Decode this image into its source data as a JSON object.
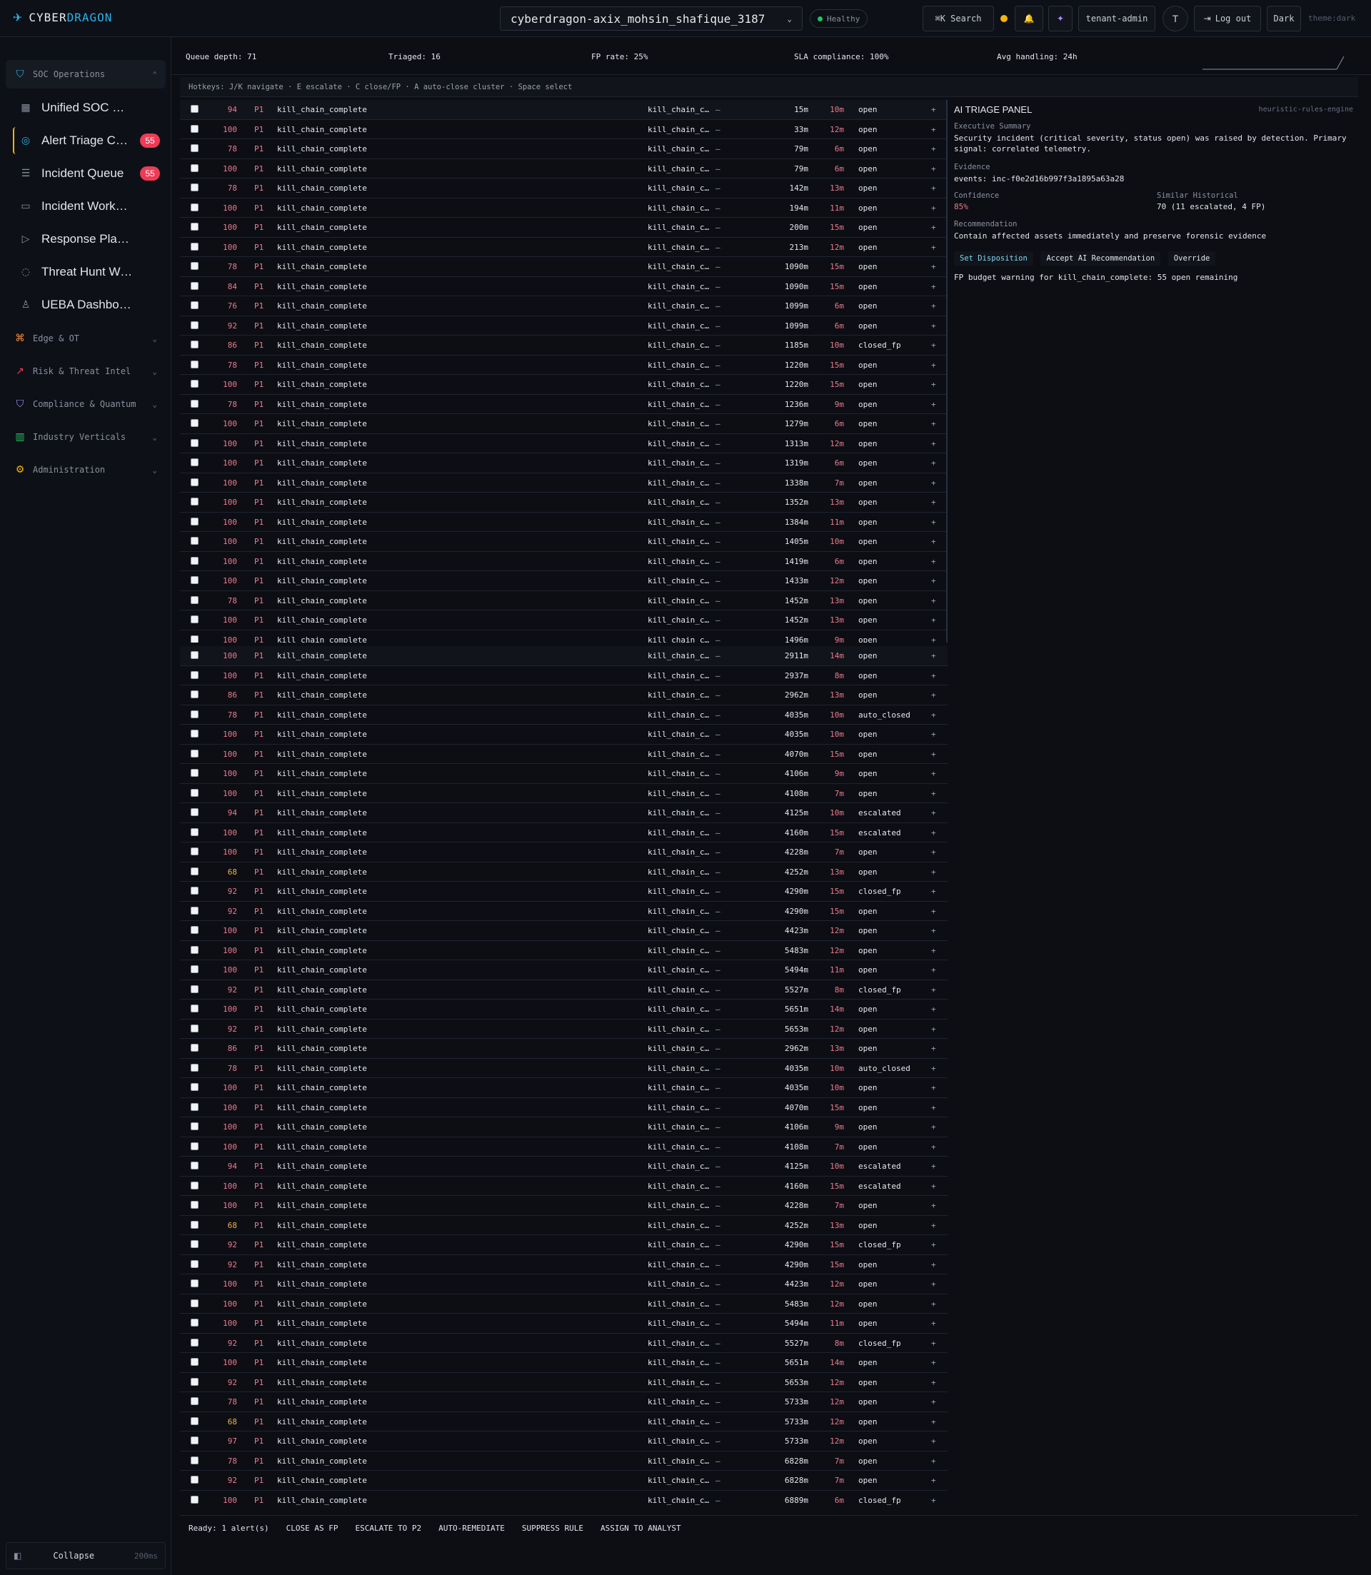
{
  "brand": {
    "part1": "CYBER",
    "part2": "DRAGON"
  },
  "header": {
    "tenant": "cyberdragon-axix_mohsin_shafique_3187",
    "health": "Healthy",
    "search_label": "⌘K  Search",
    "role": "tenant-admin",
    "avatar": "T",
    "logout": "Log out",
    "theme_btn": "Dark",
    "theme_tag": "theme:dark"
  },
  "colors": {
    "accent": "#2bb3e8",
    "critical": "#ef3b55",
    "amber": "#f5b50a",
    "healthy": "#22c55e"
  },
  "sidebar": {
    "sections": [
      {
        "label": "SOC Operations",
        "icon": "shield-icon",
        "expanded": true
      },
      {
        "label": "Edge & OT",
        "icon": "network-icon"
      },
      {
        "label": "Risk & Threat Intel",
        "icon": "trend-icon"
      },
      {
        "label": "Compliance & Quantum",
        "icon": "shield-check-icon"
      },
      {
        "label": "Industry Verticals",
        "icon": "building-icon"
      },
      {
        "label": "Administration",
        "icon": "settings-icon"
      }
    ],
    "items": [
      {
        "label": "Unified SOC Dashboard",
        "icon": "grid-icon"
      },
      {
        "label": "Alert Triage Center",
        "icon": "target-icon",
        "badge": "55",
        "active": true
      },
      {
        "label": "Incident Queue",
        "icon": "list-icon",
        "badge": "55"
      },
      {
        "label": "Incident Workspace",
        "icon": "folder-icon"
      },
      {
        "label": "Response Playbooks",
        "icon": "play-icon"
      },
      {
        "label": "Threat Hunt Workbench",
        "icon": "crosshair-icon"
      },
      {
        "label": "UEBA Dashboard",
        "icon": "user-icon"
      }
    ],
    "collapse_label": "Collapse",
    "collapse_ms": "200ms"
  },
  "metrics": {
    "queue_depth": "Queue depth: 71",
    "triaged": "Triaged: 16",
    "fp_rate": "FP rate: 25%",
    "sla": "SLA compliance: 100%",
    "avg_handling": "Avg handling: 24h"
  },
  "hotkeys": "Hotkeys: J/K navigate · E escalate · C close/FP · A auto-close cluster · Space select",
  "table_rule": "kill_chain_complete",
  "table_source": "kill_chain_c…",
  "table_priority": "P1",
  "table_top": [
    [
      "94",
      "15m",
      "10m",
      "open"
    ],
    [
      "100",
      "33m",
      "12m",
      "open"
    ],
    [
      "78",
      "79m",
      "6m",
      "open"
    ],
    [
      "100",
      "79m",
      "6m",
      "open"
    ],
    [
      "78",
      "142m",
      "13m",
      "open"
    ],
    [
      "100",
      "194m",
      "11m",
      "open"
    ],
    [
      "100",
      "200m",
      "15m",
      "open"
    ],
    [
      "100",
      "213m",
      "12m",
      "open"
    ],
    [
      "78",
      "1090m",
      "15m",
      "open"
    ],
    [
      "84",
      "1090m",
      "15m",
      "open"
    ],
    [
      "76",
      "1099m",
      "6m",
      "open"
    ],
    [
      "92",
      "1099m",
      "6m",
      "open"
    ],
    [
      "86",
      "1185m",
      "10m",
      "closed_fp"
    ],
    [
      "78",
      "1220m",
      "15m",
      "open"
    ],
    [
      "100",
      "1220m",
      "15m",
      "open"
    ],
    [
      "78",
      "1236m",
      "9m",
      "open"
    ],
    [
      "100",
      "1279m",
      "6m",
      "open"
    ],
    [
      "100",
      "1313m",
      "12m",
      "open"
    ],
    [
      "100",
      "1319m",
      "6m",
      "open"
    ],
    [
      "100",
      "1338m",
      "7m",
      "open"
    ],
    [
      "100",
      "1352m",
      "13m",
      "open"
    ],
    [
      "100",
      "1384m",
      "11m",
      "open"
    ],
    [
      "100",
      "1405m",
      "10m",
      "open"
    ],
    [
      "100",
      "1419m",
      "6m",
      "open"
    ],
    [
      "100",
      "1433m",
      "12m",
      "open"
    ],
    [
      "78",
      "1452m",
      "13m",
      "open"
    ],
    [
      "100",
      "1452m",
      "13m",
      "open"
    ],
    [
      "100",
      "1496m",
      "9m",
      "open"
    ]
  ],
  "table_bottom": [
    [
      "100",
      "2911m",
      "14m",
      "open"
    ],
    [
      "100",
      "2937m",
      "8m",
      "open"
    ],
    [
      "86",
      "2962m",
      "13m",
      "open"
    ],
    [
      "78",
      "4035m",
      "10m",
      "auto_closed"
    ],
    [
      "100",
      "4035m",
      "10m",
      "open"
    ],
    [
      "100",
      "4070m",
      "15m",
      "open"
    ],
    [
      "100",
      "4106m",
      "9m",
      "open"
    ],
    [
      "100",
      "4108m",
      "7m",
      "open"
    ],
    [
      "94",
      "4125m",
      "10m",
      "escalated"
    ],
    [
      "100",
      "4160m",
      "15m",
      "escalated"
    ],
    [
      "100",
      "4228m",
      "7m",
      "open"
    ],
    [
      "68",
      "4252m",
      "13m",
      "open"
    ],
    [
      "92",
      "4290m",
      "15m",
      "closed_fp"
    ],
    [
      "92",
      "4290m",
      "15m",
      "open"
    ],
    [
      "100",
      "4423m",
      "12m",
      "open"
    ],
    [
      "100",
      "5483m",
      "12m",
      "open"
    ],
    [
      "100",
      "5494m",
      "11m",
      "open"
    ],
    [
      "92",
      "5527m",
      "8m",
      "closed_fp"
    ],
    [
      "100",
      "5651m",
      "14m",
      "open"
    ],
    [
      "92",
      "5653m",
      "12m",
      "open"
    ],
    [
      "86",
      "2962m",
      "13m",
      "open"
    ],
    [
      "78",
      "4035m",
      "10m",
      "auto_closed"
    ],
    [
      "100",
      "4035m",
      "10m",
      "open"
    ],
    [
      "100",
      "4070m",
      "15m",
      "open"
    ],
    [
      "100",
      "4106m",
      "9m",
      "open"
    ],
    [
      "100",
      "4108m",
      "7m",
      "open"
    ],
    [
      "94",
      "4125m",
      "10m",
      "escalated"
    ],
    [
      "100",
      "4160m",
      "15m",
      "escalated"
    ],
    [
      "100",
      "4228m",
      "7m",
      "open"
    ],
    [
      "68",
      "4252m",
      "13m",
      "open"
    ],
    [
      "92",
      "4290m",
      "15m",
      "closed_fp"
    ],
    [
      "92",
      "4290m",
      "15m",
      "open"
    ],
    [
      "100",
      "4423m",
      "12m",
      "open"
    ],
    [
      "100",
      "5483m",
      "12m",
      "open"
    ],
    [
      "100",
      "5494m",
      "11m",
      "open"
    ],
    [
      "92",
      "5527m",
      "8m",
      "closed_fp"
    ],
    [
      "100",
      "5651m",
      "14m",
      "open"
    ],
    [
      "92",
      "5653m",
      "12m",
      "open"
    ],
    [
      "78",
      "5733m",
      "12m",
      "open"
    ],
    [
      "68",
      "5733m",
      "12m",
      "open"
    ],
    [
      "97",
      "5733m",
      "12m",
      "open"
    ],
    [
      "78",
      "6828m",
      "7m",
      "open"
    ],
    [
      "92",
      "6828m",
      "7m",
      "open"
    ],
    [
      "100",
      "6889m",
      "6m",
      "closed_fp"
    ]
  ],
  "ai_panel": {
    "title": "AI TRIAGE PANEL",
    "engine": "heuristic-rules-engine",
    "summary_label": "Executive Summary",
    "summary": "Security incident (critical severity, status open) was raised by detection. Primary signal: correlated telemetry.",
    "evidence_label": "Evidence",
    "evidence": "events: inc-f0e2d16b997f3a1895a63a28",
    "confidence_label": "Confidence",
    "confidence": "85%",
    "similar_label": "Similar Historical",
    "similar": "70 (11 escalated, 4 FP)",
    "recommendation_label": "Recommendation",
    "recommendation": "Contain affected assets immediately and preserve forensic evidence",
    "btn_disposition": "Set Disposition",
    "btn_accept": "Accept AI Recommendation",
    "btn_override": "Override",
    "warning": "FP budget warning for kill_chain_complete: 55 open remaining"
  },
  "actionbar": {
    "ready": "Ready: 1 alert(s)",
    "close_fp": "CLOSE AS FP",
    "escalate": "ESCALATE TO P2",
    "auto_remediate": "AUTO-REMEDIATE",
    "suppress": "SUPPRESS RULE",
    "assign": "ASSIGN TO ANALYST"
  }
}
